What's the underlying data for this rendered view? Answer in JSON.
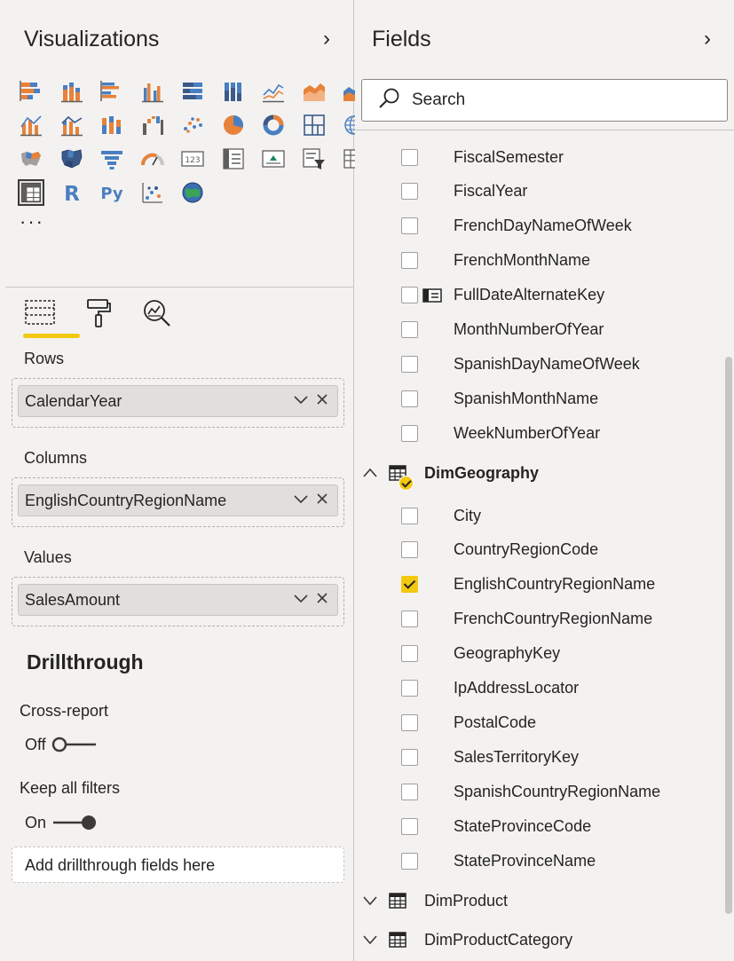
{
  "visualizations": {
    "title": "Visualizations",
    "more_label": "···",
    "icons": [
      "stacked-bar-icon",
      "stacked-column-icon",
      "clustered-bar-icon",
      "clustered-column-icon",
      "100-stacked-bar-icon",
      "100-stacked-column-icon",
      "line-chart-icon",
      "area-chart-icon",
      "stacked-area-icon",
      "line-clustered-column-icon",
      "line-stacked-column-icon",
      "ribbon-chart-icon",
      "waterfall-chart-icon",
      "scatter-chart-icon",
      "pie-chart-icon",
      "donut-chart-icon",
      "treemap-icon",
      "map-icon",
      "filled-map-icon",
      "shape-map-icon",
      "funnel-icon",
      "gauge-icon",
      "card-icon",
      "multi-row-card-icon",
      "kpi-icon",
      "slicer-icon",
      "table-icon",
      "matrix-icon",
      "r-visual-icon",
      "python-visual-icon",
      "key-influencers-icon",
      "arcgis-map-icon"
    ],
    "selected_icon": "matrix-icon"
  },
  "wells": {
    "rows": {
      "label": "Rows",
      "value": "CalendarYear"
    },
    "columns": {
      "label": "Columns",
      "value": "EnglishCountryRegionName"
    },
    "values": {
      "label": "Values",
      "value": "SalesAmount"
    }
  },
  "drillthrough": {
    "title": "Drillthrough",
    "cross_report": {
      "label": "Cross-report",
      "state": "Off"
    },
    "keep_filters": {
      "label": "Keep all filters",
      "state": "On"
    },
    "drop_placeholder": "Add drillthrough fields here"
  },
  "fields": {
    "title": "Fields",
    "search_placeholder": "Search",
    "date_fields": [
      {
        "name": "FiscalSemester",
        "checked": false
      },
      {
        "name": "FiscalYear",
        "checked": false
      },
      {
        "name": "FrenchDayNameOfWeek",
        "checked": false
      },
      {
        "name": "FrenchMonthName",
        "checked": false
      },
      {
        "name": "FullDateAlternateKey",
        "checked": false
      },
      {
        "name": "MonthNumberOfYear",
        "checked": false
      },
      {
        "name": "SpanishDayNameOfWeek",
        "checked": false
      },
      {
        "name": "SpanishMonthName",
        "checked": false
      },
      {
        "name": "WeekNumberOfYear",
        "checked": false
      }
    ],
    "geography_table": "DimGeography",
    "geography_fields": [
      {
        "name": "City",
        "checked": false
      },
      {
        "name": "CountryRegionCode",
        "checked": false
      },
      {
        "name": "EnglishCountryRegionName",
        "checked": true
      },
      {
        "name": "FrenchCountryRegionName",
        "checked": false
      },
      {
        "name": "GeographyKey",
        "checked": false
      },
      {
        "name": "IpAddressLocator",
        "checked": false
      },
      {
        "name": "PostalCode",
        "checked": false
      },
      {
        "name": "SalesTerritoryKey",
        "checked": false
      },
      {
        "name": "SpanishCountryRegionName",
        "checked": false
      },
      {
        "name": "StateProvinceCode",
        "checked": false
      },
      {
        "name": "StateProvinceName",
        "checked": false
      }
    ],
    "product_table": "DimProduct",
    "product_category_table": "DimProductCategory"
  },
  "colors": {
    "accent": "#f2c811",
    "chart_orange": "#e8823a",
    "chart_blue": "#4a7fc1",
    "pane_bg": "#f3f2f1"
  }
}
